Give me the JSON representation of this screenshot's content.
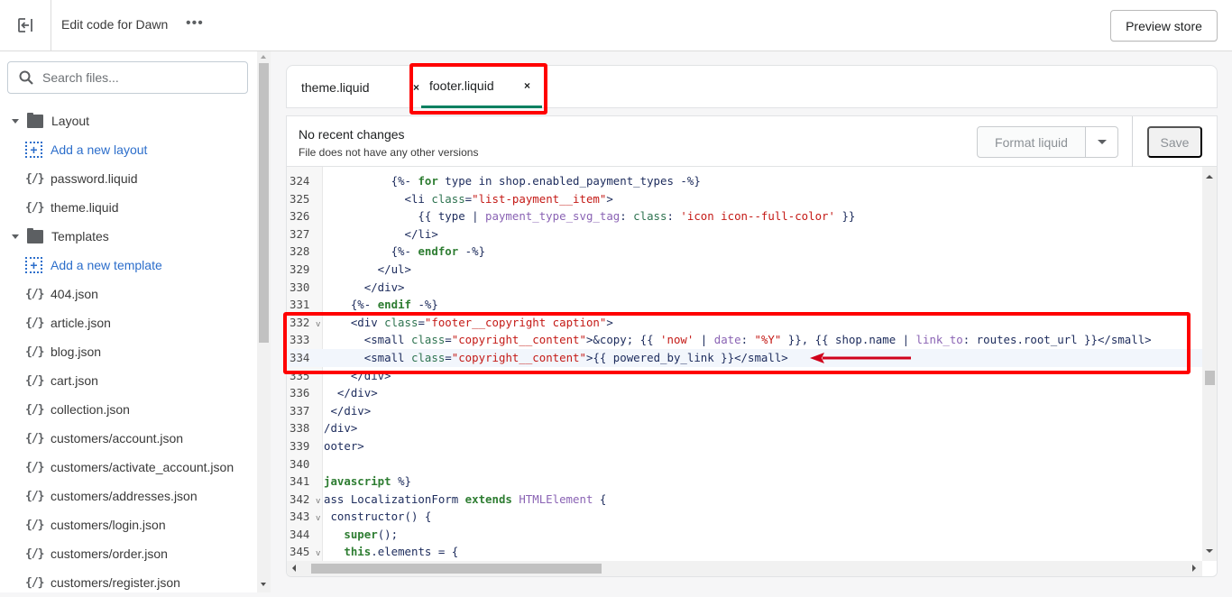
{
  "header": {
    "title": "Edit code for Dawn",
    "more_label": "•••",
    "preview_label": "Preview store"
  },
  "sidebar": {
    "search_placeholder": "Search files...",
    "sections": [
      {
        "name": "Layout",
        "add_label": "Add a new layout",
        "files": [
          "password.liquid",
          "theme.liquid"
        ]
      },
      {
        "name": "Templates",
        "add_label": "Add a new template",
        "files": [
          "404.json",
          "article.json",
          "blog.json",
          "cart.json",
          "collection.json",
          "customers/account.json",
          "customers/activate_account.json",
          "customers/addresses.json",
          "customers/login.json",
          "customers/order.json",
          "customers/register.json"
        ]
      }
    ],
    "file_icon": "{/}"
  },
  "tabs": [
    {
      "label": "theme.liquid",
      "close": "×",
      "active": false
    },
    {
      "label": "footer.liquid",
      "close": "×",
      "active": true
    }
  ],
  "info": {
    "title": "No recent changes",
    "subtitle": "File does not have any other versions",
    "format_label": "Format liquid",
    "save_label": "Save"
  },
  "editor": {
    "lines": [
      {
        "n": "324",
        "fold": "",
        "tokens": [
          [
            "p",
            "          "
          ],
          [
            "p",
            "{%- "
          ],
          [
            "k",
            "for"
          ],
          [
            "p",
            " type in shop.enabled_payment_types -%}"
          ]
        ]
      },
      {
        "n": "325",
        "fold": "",
        "tokens": [
          [
            "p",
            "            <li "
          ],
          [
            "a",
            "class"
          ],
          [
            "p",
            "="
          ],
          [
            "s",
            "\"list-payment__item\""
          ],
          [
            "p",
            ">"
          ]
        ]
      },
      {
        "n": "326",
        "fold": "",
        "tokens": [
          [
            "p",
            "              {{ type | "
          ],
          [
            "f",
            "payment_type_svg_tag"
          ],
          [
            "p",
            ": "
          ],
          [
            "a",
            "class"
          ],
          [
            "p",
            ": "
          ],
          [
            "s",
            "'icon icon--full-color'"
          ],
          [
            "p",
            " }}"
          ]
        ]
      },
      {
        "n": "327",
        "fold": "",
        "tokens": [
          [
            "p",
            "            </li>"
          ]
        ]
      },
      {
        "n": "328",
        "fold": "",
        "tokens": [
          [
            "p",
            "          {%- "
          ],
          [
            "k",
            "endfor"
          ],
          [
            "p",
            " -%}"
          ]
        ]
      },
      {
        "n": "329",
        "fold": "",
        "tokens": [
          [
            "p",
            "        </ul>"
          ]
        ]
      },
      {
        "n": "330",
        "fold": "",
        "tokens": [
          [
            "p",
            "      </div>"
          ]
        ]
      },
      {
        "n": "331",
        "fold": "",
        "tokens": [
          [
            "p",
            "    {%- "
          ],
          [
            "k",
            "endif"
          ],
          [
            "p",
            " -%}"
          ]
        ]
      },
      {
        "n": "332",
        "fold": "v",
        "tokens": [
          [
            "p",
            "    <div "
          ],
          [
            "a",
            "class"
          ],
          [
            "p",
            "="
          ],
          [
            "s",
            "\"footer__copyright caption\""
          ],
          [
            "p",
            ">"
          ]
        ]
      },
      {
        "n": "333",
        "fold": "",
        "tokens": [
          [
            "p",
            "      <small "
          ],
          [
            "a",
            "class"
          ],
          [
            "p",
            "="
          ],
          [
            "s",
            "\"copyright__content\""
          ],
          [
            "p",
            ">&copy; {{ "
          ],
          [
            "s",
            "'now'"
          ],
          [
            "p",
            " | "
          ],
          [
            "f",
            "date"
          ],
          [
            "p",
            ": "
          ],
          [
            "s",
            "\"%Y\""
          ],
          [
            "p",
            " }}, {{ shop.name | "
          ],
          [
            "f",
            "link_to"
          ],
          [
            "p",
            ": routes.root_url }}</small>"
          ]
        ]
      },
      {
        "n": "334",
        "fold": "",
        "active": true,
        "tokens": [
          [
            "p",
            "      <small "
          ],
          [
            "a",
            "class"
          ],
          [
            "p",
            "="
          ],
          [
            "s",
            "\"copyright__content\""
          ],
          [
            "p",
            ">{{ powered_by_link }}</small>"
          ]
        ]
      },
      {
        "n": "335",
        "fold": "",
        "tokens": [
          [
            "p",
            "    </div>"
          ]
        ]
      },
      {
        "n": "336",
        "fold": "",
        "tokens": [
          [
            "p",
            "  </div>"
          ]
        ]
      },
      {
        "n": "337",
        "fold": "",
        "tokens": [
          [
            "p",
            " </div>"
          ]
        ]
      },
      {
        "n": "338",
        "fold": "",
        "tokens": [
          [
            "p",
            "/div>"
          ]
        ]
      },
      {
        "n": "339",
        "fold": "",
        "tokens": [
          [
            "p",
            "ooter>"
          ]
        ]
      },
      {
        "n": "340",
        "fold": "",
        "tokens": [
          [
            "p",
            ""
          ]
        ]
      },
      {
        "n": "341",
        "fold": "",
        "tokens": [
          [
            "k",
            "javascript"
          ],
          [
            "p",
            " %}"
          ]
        ]
      },
      {
        "n": "342",
        "fold": "v",
        "tokens": [
          [
            "p",
            "ass LocalizationForm "
          ],
          [
            "k",
            "extends"
          ],
          [
            "p",
            " "
          ],
          [
            "f",
            "HTMLElement"
          ],
          [
            "p",
            " {"
          ]
        ]
      },
      {
        "n": "343",
        "fold": "v",
        "tokens": [
          [
            "p",
            " constructor() {"
          ]
        ]
      },
      {
        "n": "344",
        "fold": "",
        "tokens": [
          [
            "p",
            "   "
          ],
          [
            "k",
            "super"
          ],
          [
            "p",
            "();"
          ]
        ]
      },
      {
        "n": "345",
        "fold": "v",
        "tokens": [
          [
            "p",
            "   "
          ],
          [
            "k",
            "this"
          ],
          [
            "p",
            ".elements = {"
          ]
        ]
      }
    ]
  },
  "colors": {
    "accent_green": "#008060",
    "annotation_red": "#ff0000",
    "link_blue": "#2c6ecb"
  }
}
